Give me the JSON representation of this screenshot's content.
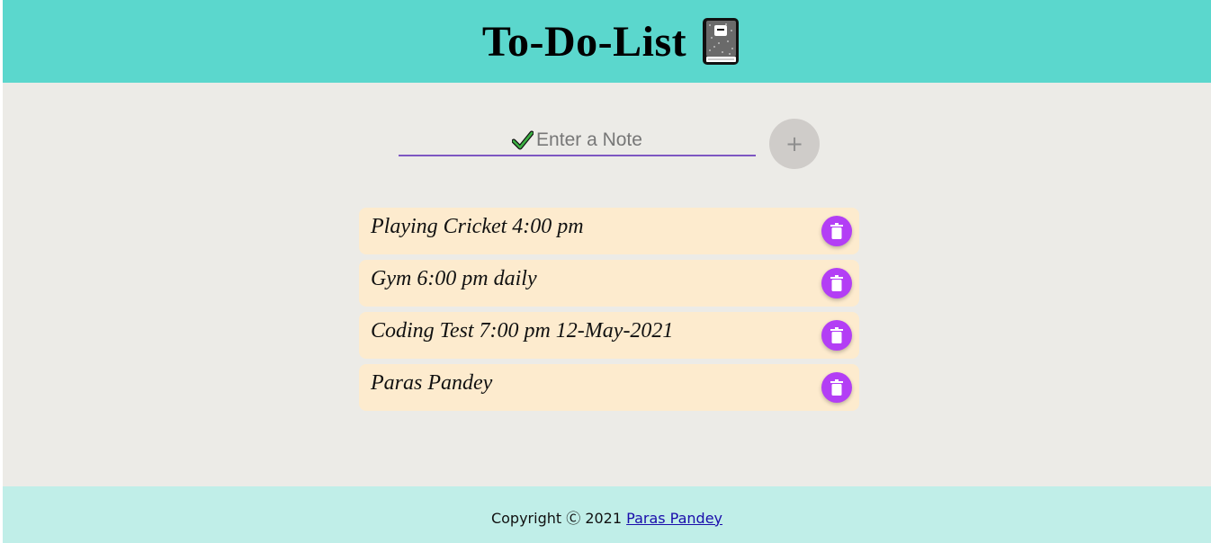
{
  "header": {
    "title": "To-Do-List",
    "icon": "notebook-icon"
  },
  "input": {
    "icon": "check-icon",
    "placeholder": "Enter a Note",
    "value": ""
  },
  "add_button": {
    "label": "+"
  },
  "todos": [
    {
      "text": "Playing Cricket 4:00 pm"
    },
    {
      "text": "Gym 6:00 pm daily"
    },
    {
      "text": "Coding Test 7:00 pm 12-May-2021"
    },
    {
      "text": "Paras Pandey"
    }
  ],
  "footer": {
    "copyright": "Copyright Ⓒ 2021",
    "author_link": "Paras Pandey"
  },
  "colors": {
    "header_bg": "#5bd7cd",
    "body_bg": "#ecebe7",
    "item_bg": "#fdebce",
    "delete_button": "#b33ef5",
    "footer_bg": "#c0eee8",
    "input_underline": "#7e57c2"
  }
}
